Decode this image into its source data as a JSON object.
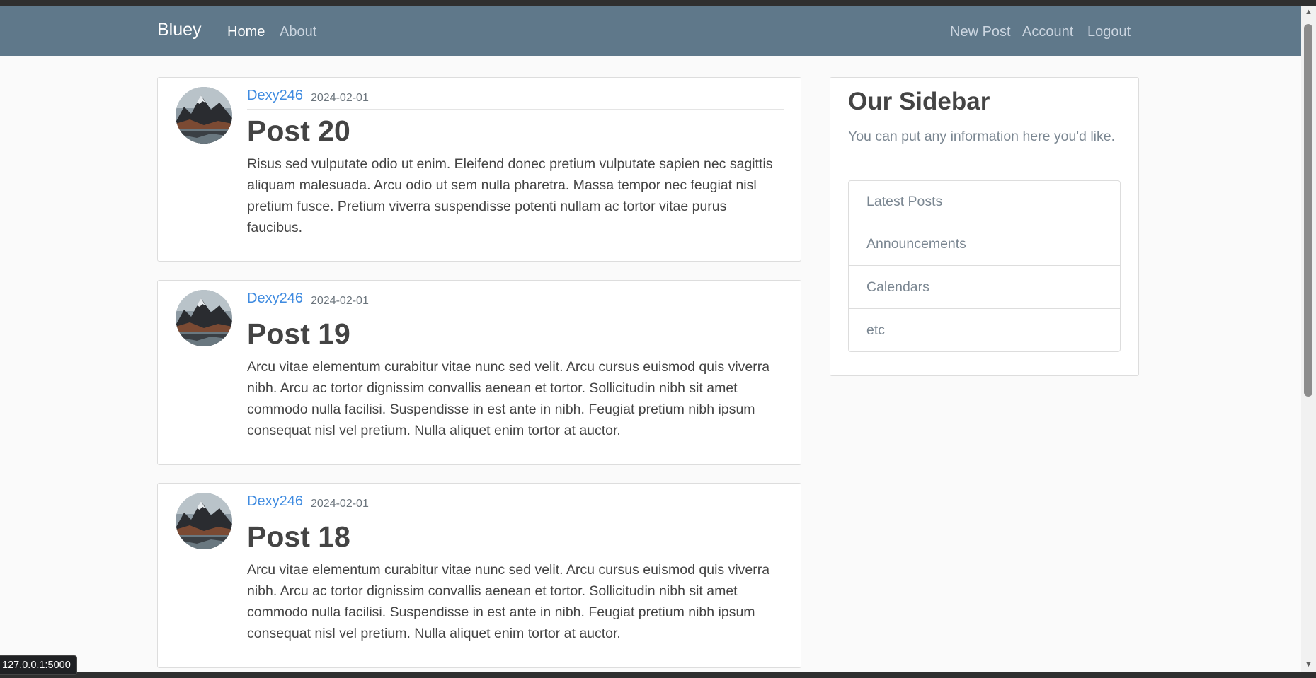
{
  "navbar": {
    "brand": "Bluey",
    "left_links": [
      "Home",
      "About"
    ],
    "right_links": [
      "New Post",
      "Account",
      "Logout"
    ]
  },
  "posts": [
    {
      "author": "Dexy246",
      "date": "2024-02-01",
      "title": "Post 20",
      "body": "Risus sed vulputate odio ut enim. Eleifend donec pretium vulputate sapien nec sagittis aliquam malesuada. Arcu odio ut sem nulla pharetra. Massa tempor nec feugiat nisl pretium fusce. Pretium viverra suspendisse potenti nullam ac tortor vitae purus faucibus."
    },
    {
      "author": "Dexy246",
      "date": "2024-02-01",
      "title": "Post 19",
      "body": "Arcu vitae elementum curabitur vitae nunc sed velit. Arcu cursus euismod quis viverra nibh. Arcu ac tortor dignissim convallis aenean et tortor. Sollicitudin nibh sit amet commodo nulla facilisi. Suspendisse in est ante in nibh. Feugiat pretium nibh ipsum consequat nisl vel pretium. Nulla aliquet enim tortor at auctor."
    },
    {
      "author": "Dexy246",
      "date": "2024-02-01",
      "title": "Post 18",
      "body": "Arcu vitae elementum curabitur vitae nunc sed velit. Arcu cursus euismod quis viverra nibh. Arcu ac tortor dignissim convallis aenean et tortor. Sollicitudin nibh sit amet commodo nulla facilisi. Suspendisse in est ante in nibh. Feugiat pretium nibh ipsum consequat nisl vel pretium. Nulla aliquet enim tortor at auctor."
    }
  ],
  "sidebar": {
    "title": "Our Sidebar",
    "text": "You can put any information here you'd like.",
    "items": [
      "Latest Posts",
      "Announcements",
      "Calendars",
      "etc"
    ]
  },
  "status_bar": {
    "url": "127.0.0.1:5000"
  },
  "colors": {
    "navbar_bg": "#5f788a",
    "link_blue": "#3f8be0",
    "page_bg": "#fafafa"
  },
  "icons": {
    "avatar": "profile-picture-mountain-lake",
    "scroll_up": "chevron-up-icon",
    "scroll_down": "chevron-down-icon"
  }
}
